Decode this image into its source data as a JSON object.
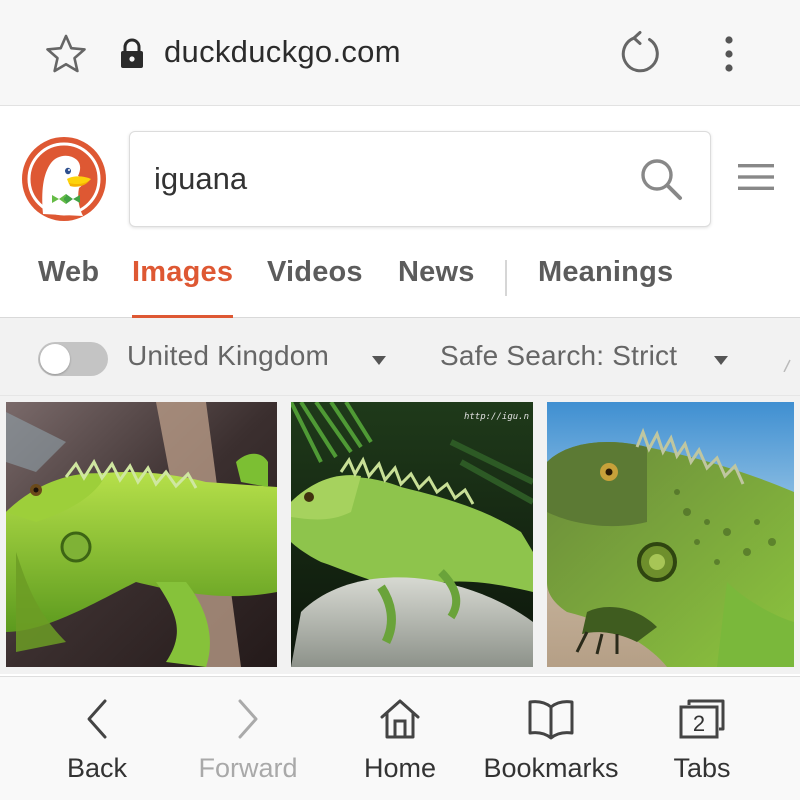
{
  "browser": {
    "url": "duckduckgo.com",
    "icons": {
      "bookmark": "star-icon",
      "secure": "lock-icon",
      "reload": "reload-icon",
      "menu": "kebab-menu-icon"
    }
  },
  "header": {
    "logo": "duckduckgo-logo",
    "search": {
      "value": "iguana"
    },
    "tabs": [
      {
        "label": "Web",
        "active": false
      },
      {
        "label": "Images",
        "active": true
      },
      {
        "label": "Videos",
        "active": false
      },
      {
        "label": "News",
        "active": false
      },
      {
        "label": "Meanings",
        "active": false
      }
    ]
  },
  "filters": {
    "region_toggle_on": false,
    "region": "United Kingdom",
    "safe_search": "Safe Search: Strict"
  },
  "images": [
    {
      "subject": "green iguana on branch"
    },
    {
      "subject": "green iguana on rock",
      "watermark": "http://igu.n"
    },
    {
      "subject": "green iguana close-up"
    }
  ],
  "bottom_nav": {
    "back": "Back",
    "forward": "Forward",
    "home": "Home",
    "bookmarks": "Bookmarks",
    "tabs": "Tabs",
    "tab_count": "2"
  },
  "colors": {
    "accent": "#de5833",
    "brand_logo_bg": "#de5833"
  }
}
